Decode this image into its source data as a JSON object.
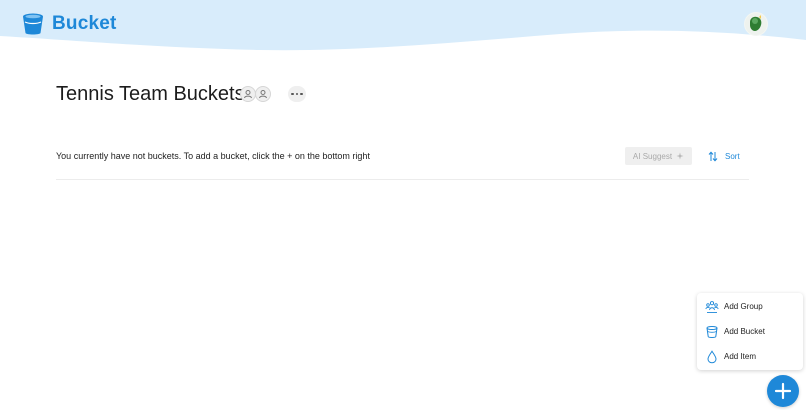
{
  "header": {
    "app_name": "Bucket",
    "brand_color": "#1e88d8",
    "banner_color": "#d8ecfb",
    "logo_icon": "bucket-icon",
    "avatar_icon": "user-avatar-icon"
  },
  "page": {
    "title": "Tennis Team Buckets",
    "member_icons": [
      "person-icon",
      "person-icon"
    ],
    "more_icon": "more-horizontal-icon"
  },
  "empty_state": {
    "message": "You currently have not buckets. To add a bucket, click the + on the bottom right"
  },
  "actions": {
    "ai_suggest_label": "AI Suggest",
    "ai_suggest_icon": "sparkle-icon",
    "sort_label": "Sort",
    "sort_icon": "sort-arrows-icon"
  },
  "add_menu": {
    "items": [
      {
        "label": "Add Group",
        "icon": "group-icon"
      },
      {
        "label": "Add Bucket",
        "icon": "bucket-outline-icon"
      },
      {
        "label": "Add Item",
        "icon": "drop-icon"
      }
    ]
  },
  "fab": {
    "icon": "plus-icon",
    "color": "#1e88d8"
  }
}
